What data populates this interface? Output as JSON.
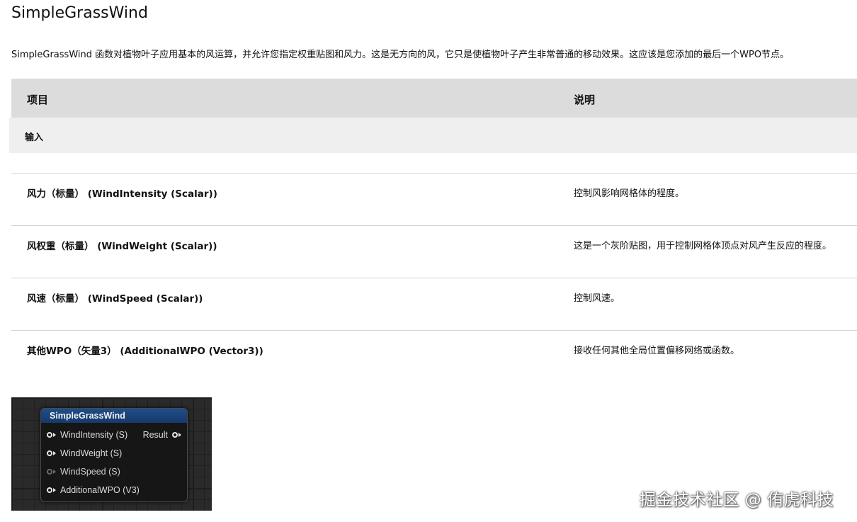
{
  "title": "SimpleGrassWind",
  "intro": "SimpleGrassWind 函数对植物叶子应用基本的风运算，并允许您指定权重贴图和风力。这是无方向的风，它只是使植物叶子产生非常普通的移动效果。这应该是您添加的最后一个WPO节点。",
  "table": {
    "header_item": "项目",
    "header_desc": "说明",
    "group_label": "输入",
    "rows": [
      {
        "name": "风力（标量） (WindIntensity (Scalar))",
        "desc": "控制风影响网格体的程度。"
      },
      {
        "name": "风权重（标量） (WindWeight (Scalar))",
        "desc": "这是一个灰阶贴图，用于控制网格体顶点对风产生反应的程度。"
      },
      {
        "name": "风速（标量） (WindSpeed (Scalar))",
        "desc": "控制风速。"
      },
      {
        "name": "其他WPO（矢量3） (AdditionalWPO (Vector3))",
        "desc": "接收任何其他全局位置偏移网络或函数。"
      }
    ]
  },
  "node": {
    "title": "SimpleGrassWind",
    "inputs": [
      {
        "label": "WindIntensity (S)",
        "connected": true
      },
      {
        "label": "WindWeight (S)",
        "connected": true
      },
      {
        "label": "WindSpeed (S)",
        "connected": false
      },
      {
        "label": "AdditionalWPO (V3)",
        "connected": true
      }
    ],
    "output": "Result",
    "header_color": "#1f4d8a"
  },
  "watermark": "掘金技术社区 @ 侑虎科技"
}
